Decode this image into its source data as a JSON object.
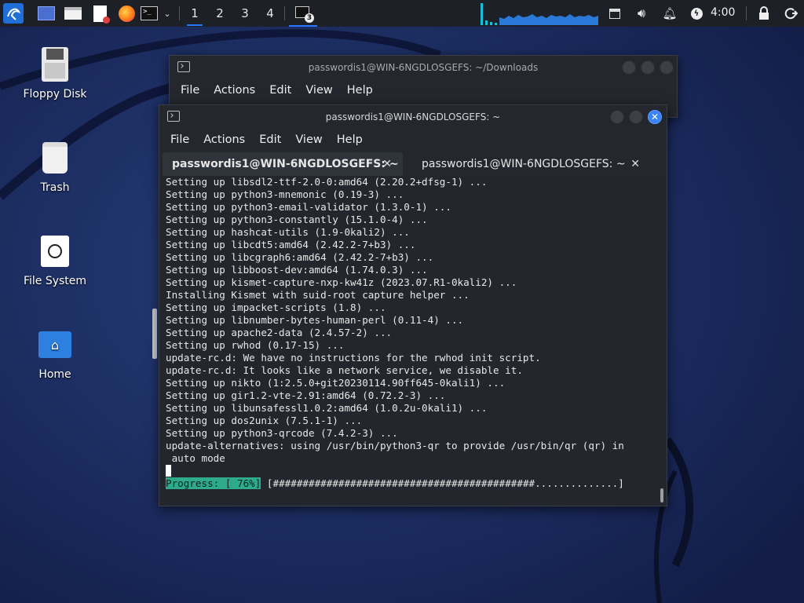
{
  "taskbar": {
    "workspaces": [
      "1",
      "2",
      "3",
      "4"
    ],
    "active_workspace": "1",
    "terminal_badge": "3",
    "clock": "4:00"
  },
  "desktop": {
    "icons": [
      {
        "label": "Floppy Disk",
        "icon": "floppy-disk-icon"
      },
      {
        "label": "Trash",
        "icon": "trash-icon"
      },
      {
        "label": "File System",
        "icon": "drive-icon"
      },
      {
        "label": "Home",
        "icon": "home-folder-icon"
      }
    ]
  },
  "back_window": {
    "title": "passwordis1@WIN-6NGDLOSGEFS: ~/Downloads",
    "menu": [
      "File",
      "Actions",
      "Edit",
      "View",
      "Help"
    ]
  },
  "front_window": {
    "title": "passwordis1@WIN-6NGDLOSGEFS: ~",
    "menu": [
      "File",
      "Actions",
      "Edit",
      "View",
      "Help"
    ],
    "tabs": [
      {
        "label": "passwordis1@WIN-6NGDLOSGEFS: ~",
        "active": true
      },
      {
        "label": "passwordis1@WIN-6NGDLOSGEFS: ~",
        "active": false
      }
    ],
    "lines": [
      "Setting up libsdl2-ttf-2.0-0:amd64 (2.20.2+dfsg-1) ...",
      "Setting up python3-mnemonic (0.19-3) ...",
      "Setting up python3-email-validator (1.3.0-1) ...",
      "Setting up python3-constantly (15.1.0-4) ...",
      "Setting up hashcat-utils (1.9-0kali2) ...",
      "Setting up libcdt5:amd64 (2.42.2-7+b3) ...",
      "Setting up libcgraph6:amd64 (2.42.2-7+b3) ...",
      "Setting up libboost-dev:amd64 (1.74.0.3) ...",
      "Setting up kismet-capture-nxp-kw41z (2023.07.R1-0kali2) ...",
      "Installing Kismet with suid-root capture helper ...",
      "Setting up impacket-scripts (1.8) ...",
      "Setting up libnumber-bytes-human-perl (0.11-4) ...",
      "Setting up apache2-data (2.4.57-2) ...",
      "Setting up rwhod (0.17-15) ...",
      "update-rc.d: We have no instructions for the rwhod init script.",
      "update-rc.d: It looks like a network service, we disable it.",
      "Setting up nikto (1:2.5.0+git20230114.90ff645-0kali1) ...",
      "Setting up gir1.2-vte-2.91:amd64 (0.72.2-3) ...",
      "Setting up libunsafessl1.0.2:amd64 (1.0.2u-0kali1) ...",
      "Setting up dos2unix (7.5.1-1) ...",
      "Setting up python3-qrcode (7.4.2-3) ...",
      "update-alternatives: using /usr/bin/python3-qr to provide /usr/bin/qr (qr) in",
      " auto mode"
    ],
    "progress_label": "Progress: [ 76%]",
    "progress_bar": " [############################################..............]",
    "progress_percent": 76
  }
}
